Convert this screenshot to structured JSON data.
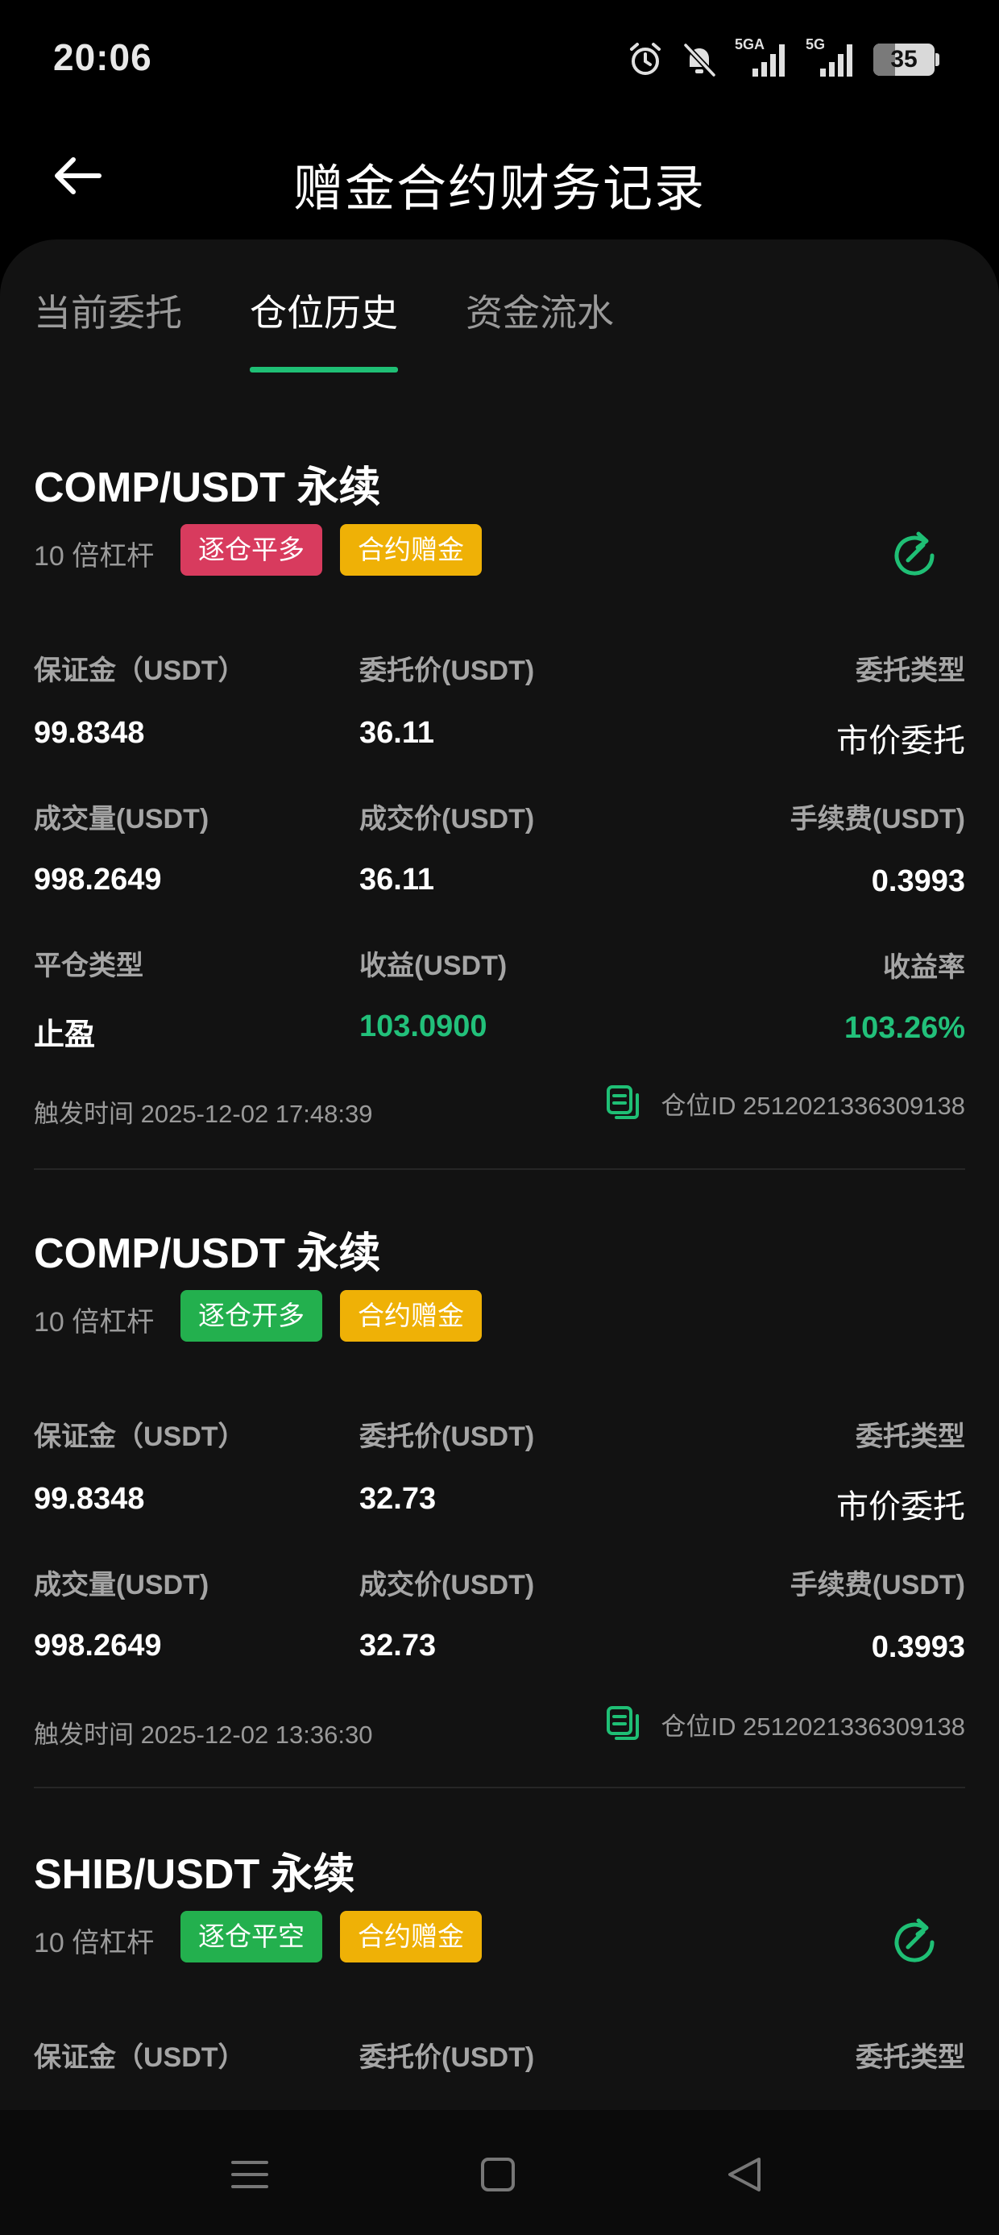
{
  "status_bar": {
    "time": "20:06",
    "battery": "35",
    "battery_level": 0.35,
    "signal_1_label": "5GA",
    "signal_2_label": "5G",
    "icons": [
      "alarm-icon",
      "mute-bell-icon",
      "signal-5ga-icon",
      "signal-5g-icon",
      "battery-icon"
    ]
  },
  "header": {
    "title": "赠金合约财务记录",
    "back_icon": "arrow-left-icon"
  },
  "tabs": [
    {
      "label": "当前委托",
      "active": false
    },
    {
      "label": "仓位历史",
      "active": true
    },
    {
      "label": "资金流水",
      "active": false
    }
  ],
  "accent_color": "#1fbf75",
  "records": [
    {
      "title": "COMP/USDT 永续",
      "leverage": "10 倍杠杆",
      "tags": [
        "逐仓平多",
        "合约赠金"
      ],
      "margin_label": "保证金（USDT）",
      "margin": "99.8348",
      "order_price_label": "委托价(USDT)",
      "order_price": "36.11",
      "order_type_label": "委托类型",
      "order_type": "市价委托",
      "volume_label": "成交量(USDT)",
      "volume": "998.2649",
      "deal_price_label": "成交价(USDT)",
      "deal_price": "36.11",
      "fee_label": "手续费(USDT)",
      "fee": "0.3993",
      "close_type_label": "平仓类型",
      "close_type": "止盈",
      "pnl_label": "收益(USDT)",
      "pnl": "103.0900",
      "pnl_rate_label": "收益率",
      "pnl_rate": "103.26%",
      "trigger_time": "触发时间 2025-12-02 17:48:39",
      "position_id": "仓位ID 2512021336309138"
    },
    {
      "title": "COMP/USDT 永续",
      "leverage": "10 倍杠杆",
      "tags": [
        "逐仓开多",
        "合约赠金"
      ],
      "margin_label": "保证金（USDT）",
      "margin": "99.8348",
      "order_price_label": "委托价(USDT)",
      "order_price": "32.73",
      "order_type_label": "委托类型",
      "order_type": "市价委托",
      "volume_label": "成交量(USDT)",
      "volume": "998.2649",
      "deal_price_label": "成交价(USDT)",
      "deal_price": "32.73",
      "fee_label": "手续费(USDT)",
      "fee": "0.3993",
      "trigger_time": "触发时间 2025-12-02 13:36:30",
      "position_id": "仓位ID 2512021336309138"
    },
    {
      "title": "SHIB/USDT 永续",
      "leverage": "10 倍杠杆",
      "tags": [
        "逐仓平空",
        "合约赠金"
      ],
      "margin_label": "保证金（USDT）",
      "order_price_label": "委托价(USDT)",
      "order_type_label": "委托类型"
    }
  ],
  "nav_bar": {
    "icons": [
      "menu-icon",
      "home-square-icon",
      "back-triangle-icon"
    ]
  }
}
